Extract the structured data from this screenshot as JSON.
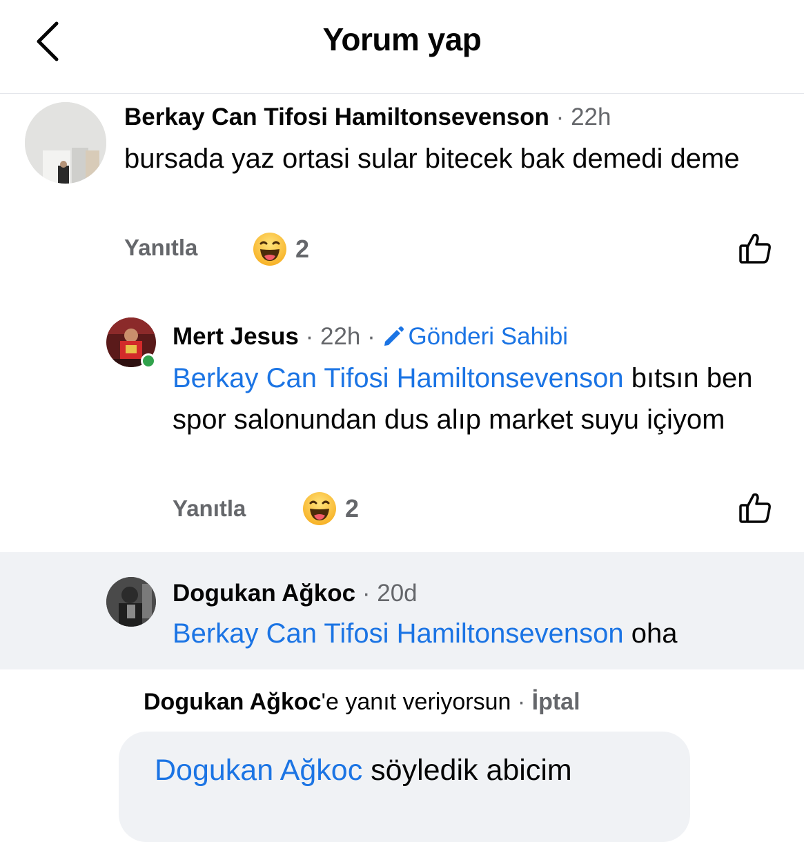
{
  "header": {
    "title": "Yorum yap",
    "back_icon": "chevron-left-icon"
  },
  "comments": [
    {
      "author": "Berkay Can Tifosi Hamiltonsevenson",
      "time": "22h",
      "text": "bursada yaz ortasi sular bitecek bak demedi deme",
      "reply_label": "Yanıtla",
      "reaction_icon": "haha-emoji-icon",
      "reaction_count": "2"
    },
    {
      "author": "Mert Jesus",
      "time": "22h",
      "badge": "Gönderi Sahibi",
      "mention": "Berkay Can Tifosi Hamiltonsevenson",
      "text": "bıtsın ben spor salonundan dus alıp market suyu içiyom",
      "reply_label": "Yanıtla",
      "reaction_icon": "haha-emoji-icon",
      "reaction_count": "2"
    },
    {
      "author": "Dogukan Ağkoc",
      "time": "20d",
      "mention": "Berkay Can Tifosi Hamiltonsevenson",
      "text": "oha"
    }
  ],
  "composer": {
    "replying_name": "Dogukan Ağkoc",
    "replying_suffix": "'e yanıt veriyorsun",
    "cancel_label": "İptal",
    "mention": "Dogukan Ağkoc",
    "text": "söyledik abicim"
  },
  "colors": {
    "link": "#1b74e4",
    "muted": "#65676b",
    "online": "#31a24c",
    "highlight_bg": "#f0f2f5"
  }
}
